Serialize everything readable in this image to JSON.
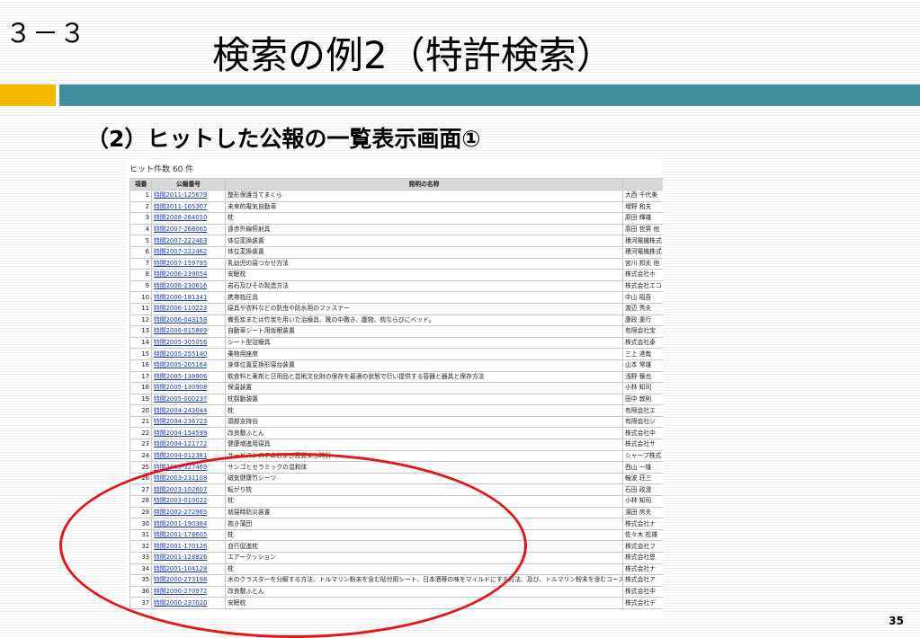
{
  "slide": {
    "section_number": "３－３",
    "title": "検索の例2（特許検索）",
    "subtitle": "（2）ヒットした公報の一覧表示画面①",
    "page_number": "35",
    "accent_colors": {
      "square": "#f5b800",
      "bar": "#3f8fa1",
      "ellipse": "#e81515"
    }
  },
  "results": {
    "hit_count": "ヒット件数 60 件",
    "headers": {
      "index": "項番",
      "pub_no": "公報番号",
      "title": "発明の名称"
    },
    "rows": [
      {
        "idx": "1",
        "pub": "特開2011-125679",
        "name": "整形保護当てまくら",
        "app": "大西 千代美"
      },
      {
        "idx": "2",
        "pub": "特開2011-105307",
        "name": "未来的電気自動車",
        "app": "増野 和夫"
      },
      {
        "idx": "3",
        "pub": "特開2008-264010",
        "name": "枕",
        "app": "原田 輝雄"
      },
      {
        "idx": "4",
        "pub": "特開2007-268065",
        "name": "遠赤外線照射具",
        "app": "原田 哲男 他"
      },
      {
        "idx": "5",
        "pub": "特開2007-222463",
        "name": "体位変換装置",
        "app": "積河電機株式"
      },
      {
        "idx": "6",
        "pub": "特開2007-222462",
        "name": "体位変換装置",
        "app": "積河電機株式"
      },
      {
        "idx": "7",
        "pub": "特開2007-159795",
        "name": "乳幼児の寝つかせ方法",
        "app": "宮川 邦夫 他"
      },
      {
        "idx": "8",
        "pub": "特開2006-239054",
        "name": "安眠枕",
        "app": "株式会社ホ"
      },
      {
        "idx": "9",
        "pub": "特開2006-230616",
        "name": "岩石及びその製造方法",
        "app": "株式会社エコ"
      },
      {
        "idx": "10",
        "pub": "特開2006-181341",
        "name": "携帯指圧具",
        "app": "中山 昭吾"
      },
      {
        "idx": "11",
        "pub": "特開2006-110223",
        "name": "寝具や衣料などの防虫や防水用のファスナー",
        "app": "渡辺 秀夫"
      },
      {
        "idx": "12",
        "pub": "特開2006-043158",
        "name": "備長炭または竹炭を用いた治療具、靴の中敷き、腹物、枕ならびにベッド。",
        "app": "康政 重行"
      },
      {
        "idx": "13",
        "pub": "特開2006-015889",
        "name": "自動車シート用仮眠装置",
        "app": "有限会社宝"
      },
      {
        "idx": "14",
        "pub": "特開2005-305056",
        "name": "シート型治療具",
        "app": "株式会社泰"
      },
      {
        "idx": "15",
        "pub": "特開2005-255140",
        "name": "乗物用座席",
        "app": "三上 達哉"
      },
      {
        "idx": "16",
        "pub": "特開2005-205164",
        "name": "身体位置変換形寝台装置",
        "app": "山本 常雄"
      },
      {
        "idx": "17",
        "pub": "特開2005-138906",
        "name": "飲食料と薬剤と日用品と芸術文化財の保存を最適の状態で行い提供する容器と器具と保存方法",
        "app": "浅野 穣也"
      },
      {
        "idx": "18",
        "pub": "特開2005-130908",
        "name": "保温装置",
        "app": "小林 知司"
      },
      {
        "idx": "19",
        "pub": "特開2005-000237",
        "name": "枕揺動装置",
        "app": "田中 敦則"
      },
      {
        "idx": "20",
        "pub": "特開2004-243044",
        "name": "枕",
        "app": "有限会社エ"
      },
      {
        "idx": "21",
        "pub": "特開2004-236723",
        "name": "頭部支持台",
        "app": "有限会社ジ"
      },
      {
        "idx": "22",
        "pub": "特開2004-154599",
        "name": "改良敷ふとん",
        "app": "株式会社中"
      },
      {
        "idx": "23",
        "pub": "特開2004-121772",
        "name": "健康増進用寝具",
        "app": "株式会社サ"
      },
      {
        "idx": "24",
        "pub": "特開2004-012381",
        "name": "サービスシステムおよび目覚まし時計",
        "app": "シャープ株式"
      },
      {
        "idx": "25",
        "pub": "特開2003-327469",
        "name": "サンゴとセラミックの混和体",
        "app": "西山 一雄"
      },
      {
        "idx": "26",
        "pub": "特開2003-231108",
        "name": "磁気健康竹シーツ",
        "app": "輪波 荘三"
      },
      {
        "idx": "27",
        "pub": "特開2003-102607",
        "name": "転がり枕",
        "app": "石田 政澄"
      },
      {
        "idx": "28",
        "pub": "特開2003-010022",
        "name": "枕",
        "app": "小林 知司"
      },
      {
        "idx": "29",
        "pub": "特開2002-272965",
        "name": "就寝時防災装置",
        "app": "濱田 房夫"
      },
      {
        "idx": "30",
        "pub": "特開2001-190384",
        "name": "抱き蒲団",
        "app": "株式会社ナ"
      },
      {
        "idx": "31",
        "pub": "特開2001-178605",
        "name": "枕",
        "app": "佐々木 松雄"
      },
      {
        "idx": "32",
        "pub": "特開2001-170126",
        "name": "血行促進枕",
        "app": "株式会社フ"
      },
      {
        "idx": "33",
        "pub": "特開2001-128826",
        "name": "エアークッション",
        "app": "株式会社恩"
      },
      {
        "idx": "34",
        "pub": "特開2001-104128",
        "name": "枕",
        "app": "株式会社ナ"
      },
      {
        "idx": "35",
        "pub": "特開2000-273198",
        "name": "水のクラスターを分解する方法、トルマリン粉末を含む貼付用シート、日本酒等の味をマイルドにする方法、及び、トルマリン粉末を含むコースター",
        "app": "株式会社ア"
      },
      {
        "idx": "36",
        "pub": "特開2000-270972",
        "name": "改良敷ふとん",
        "app": "株式会社中"
      },
      {
        "idx": "37",
        "pub": "特開2000-237020",
        "name": "安眠枕",
        "app": "株式会社デ"
      }
    ]
  }
}
